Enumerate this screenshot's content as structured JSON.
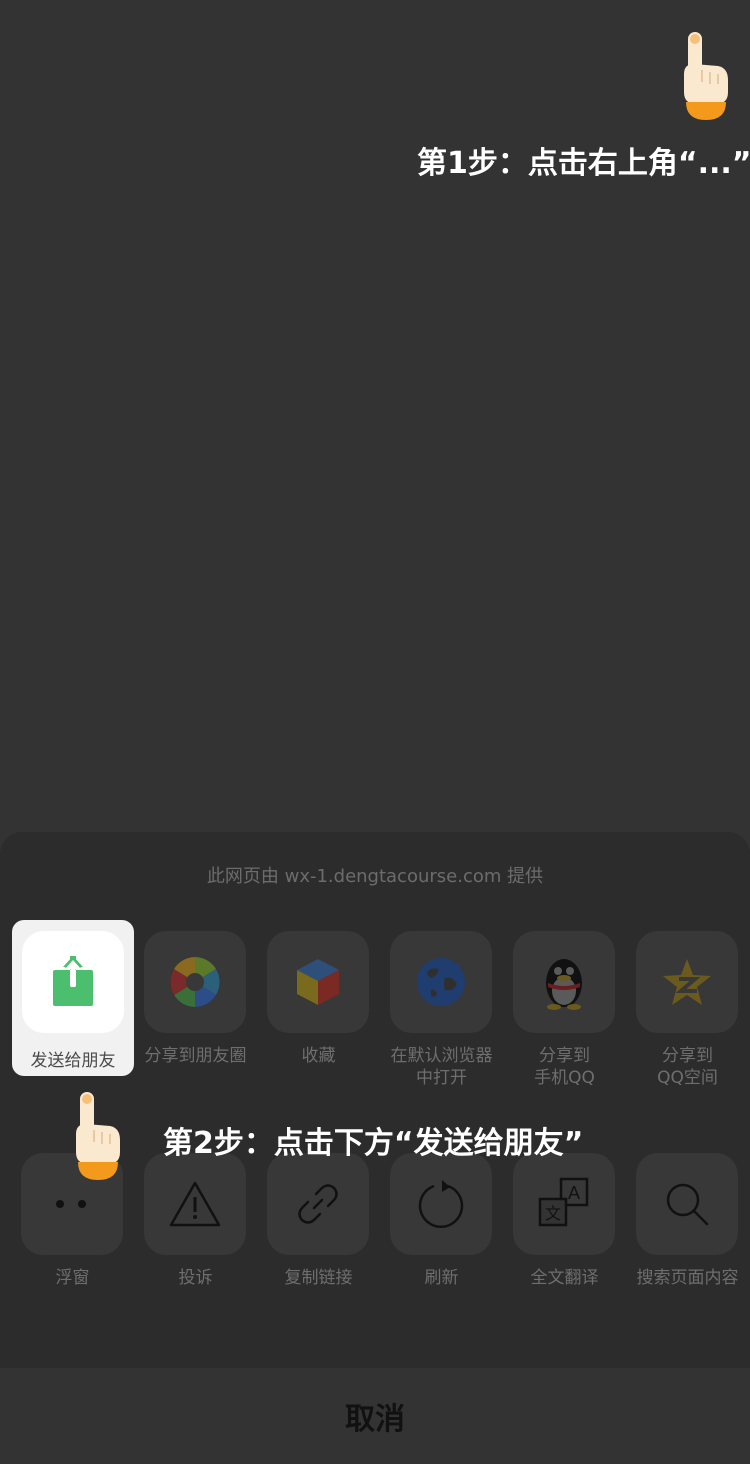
{
  "overlay": {
    "step1": "第1步：点击右上角“...”",
    "step2": "第2步：点击下方“发送给朋友”"
  },
  "sheet": {
    "provider": "此网页由 wx-1.dengtacourse.com 提供",
    "highlight_label": "发送给朋友",
    "row1": [
      {
        "icon": "share-to-moments-icon",
        "label": "分享到朋友圈"
      },
      {
        "icon": "favorite-cube-icon",
        "label": "收藏"
      },
      {
        "icon": "browser-globe-icon",
        "label": "在默认浏览器\n中打开"
      },
      {
        "icon": "qq-penguin-icon",
        "label": "分享到\n手机QQ"
      },
      {
        "icon": "qzone-star-icon",
        "label": "分享到\nQQ空间"
      }
    ],
    "row2": [
      {
        "icon": "float-window-icon",
        "label": "浮窗"
      },
      {
        "icon": "warning-icon",
        "label": "投诉"
      },
      {
        "icon": "link-icon",
        "label": "复制链接"
      },
      {
        "icon": "refresh-icon",
        "label": "刷新"
      },
      {
        "icon": "translate-icon",
        "label": "全文翻译"
      },
      {
        "icon": "search-icon",
        "label": "搜索页面内容"
      }
    ],
    "cancel_label": "取消"
  }
}
